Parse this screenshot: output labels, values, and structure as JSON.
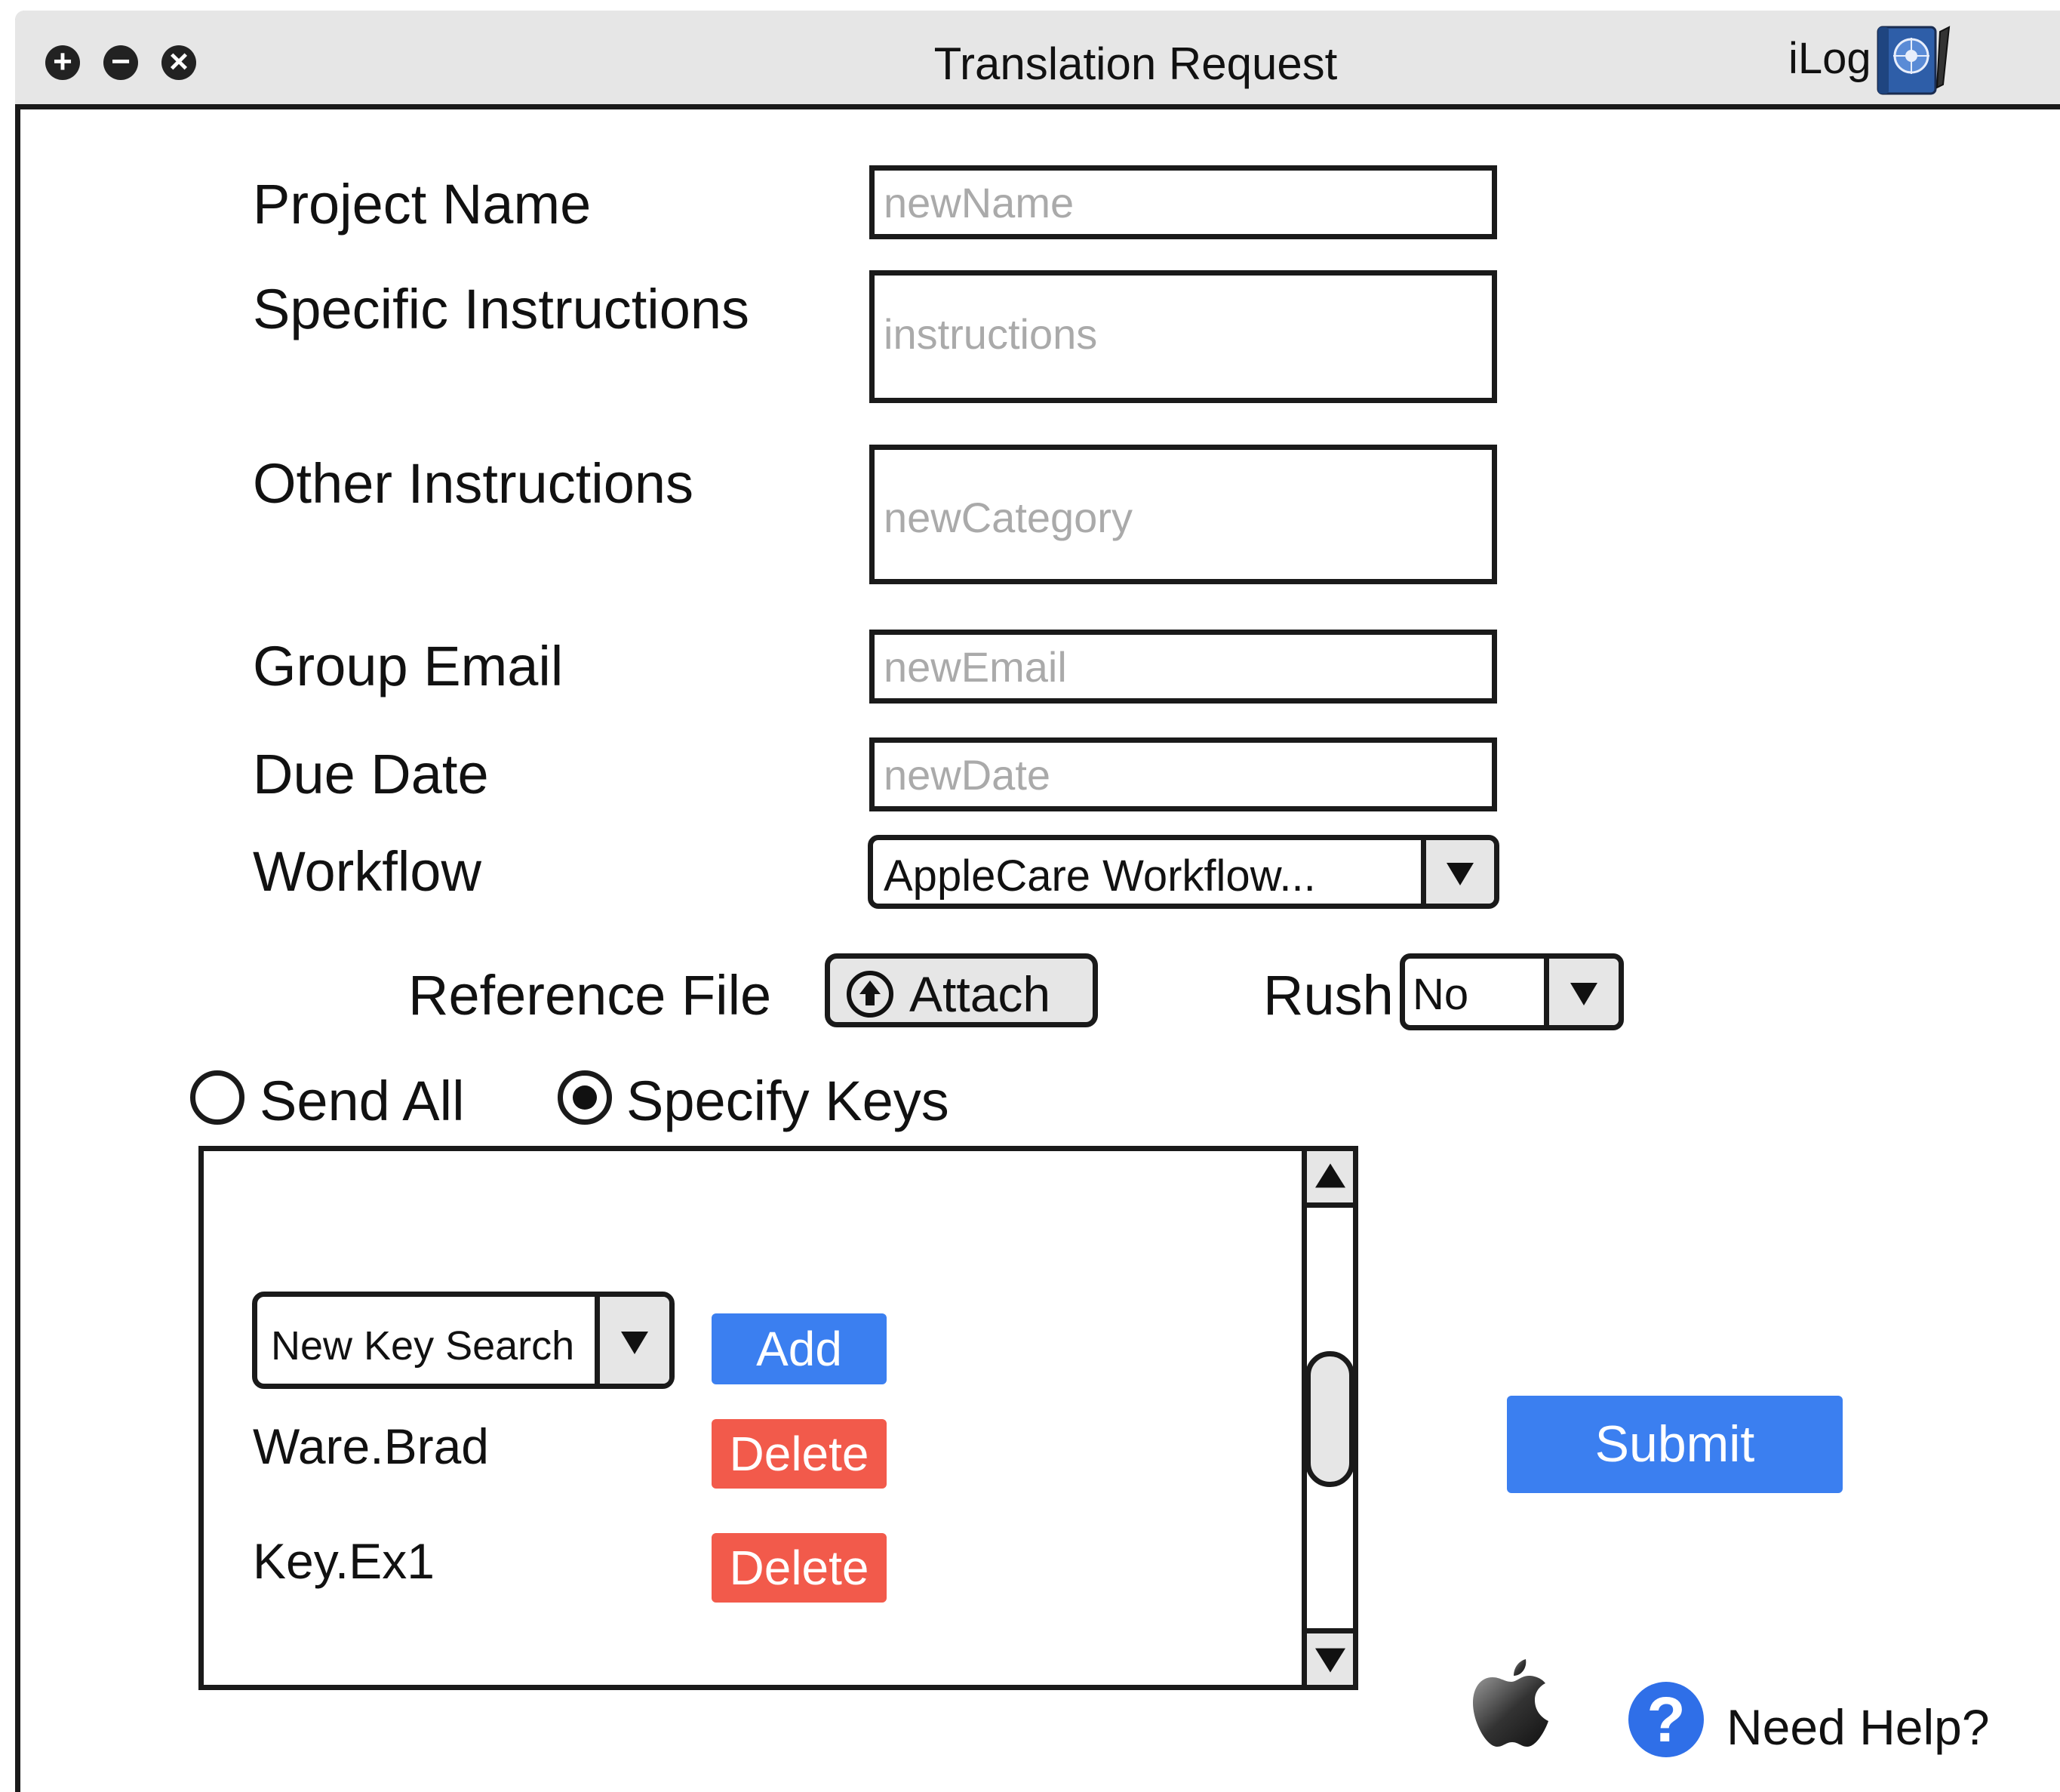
{
  "window": {
    "title": "Translation Request",
    "brand": "iLog",
    "controls": {
      "zoom": "+",
      "minimize": "−",
      "close": "×"
    }
  },
  "form": {
    "project_name": {
      "label": "Project Name",
      "placeholder": "newName"
    },
    "specific_instructions": {
      "label": "Specific Instructions",
      "placeholder": "instructions"
    },
    "other_instructions": {
      "label": "Other Instructions",
      "placeholder": "newCategory"
    },
    "group_email": {
      "label": "Group Email",
      "placeholder": "newEmail"
    },
    "due_date": {
      "label": "Due Date",
      "placeholder": "newDate"
    },
    "workflow": {
      "label": "Workflow",
      "value": "AppleCare Workflow..."
    },
    "reference_file": {
      "label": "Reference File",
      "attach_label": "Attach"
    },
    "rush": {
      "label": "Rush",
      "value": "No"
    }
  },
  "mode": {
    "send_all": {
      "label": "Send All",
      "selected": false
    },
    "specify_keys": {
      "label": "Specify Keys",
      "selected": true
    }
  },
  "keys": {
    "search": {
      "value": "New Key Search"
    },
    "add_label": "Add",
    "items": [
      {
        "name": "Ware.Brad",
        "action": "Delete"
      },
      {
        "name": "Key.Ex1",
        "action": "Delete"
      }
    ]
  },
  "actions": {
    "submit_label": "Submit"
  },
  "footer": {
    "help_label": "Need Help?",
    "help_glyph": "?"
  },
  "colors": {
    "accent_blue": "#3b7ff0",
    "delete_red": "#f25a4b",
    "help_blue": "#2f6fe8"
  }
}
